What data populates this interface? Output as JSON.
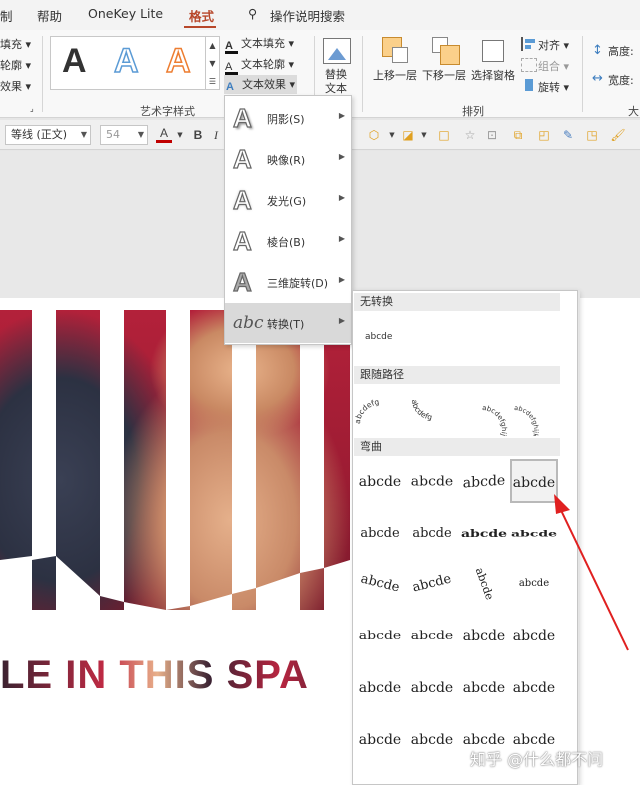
{
  "tabs": [
    {
      "label": "制"
    },
    {
      "label": "帮助"
    },
    {
      "label": "OneKey Lite"
    },
    {
      "label": "格式"
    },
    {
      "label": "操作说明搜索"
    }
  ],
  "ribbon": {
    "left_stub": [
      "填充 ▾",
      "轮廓 ▾",
      "效果 ▾"
    ],
    "wordart_samples": [
      "A",
      "A",
      "A"
    ],
    "wordart_colors": [
      "#111111",
      "#5b9bd5",
      "#ed7d31"
    ],
    "text_fill": "文本填充 ▾",
    "text_outline": "文本轮廓 ▾",
    "text_effects": "文本效果 ▾",
    "wordart_group": "艺术字样式",
    "replace_text_line1": "替换",
    "replace_text_line2": "文本",
    "bring_forward": "上移一层",
    "send_backward": "下移一层",
    "selection_pane": "选择窗格",
    "align": "对齐 ▾",
    "group": "组合 ▾",
    "rotate": "旋转 ▾",
    "arrange_group": "排列",
    "height": "高度:",
    "width": "宽度:",
    "size_stub": "大"
  },
  "formatbar": {
    "font": "等线 (正文)",
    "size": "54",
    "bold": "B",
    "italic": "I"
  },
  "slide": {
    "headline": "LE   IN THIS   SPA"
  },
  "effects_menu": [
    {
      "label": "阴影(S)",
      "glyph": "A"
    },
    {
      "label": "映像(R)",
      "glyph": "A"
    },
    {
      "label": "发光(G)",
      "glyph": "A"
    },
    {
      "label": "棱台(B)",
      "glyph": "A"
    },
    {
      "label": "三维旋转(D)",
      "glyph": "A"
    },
    {
      "label": "转换(T)",
      "glyph": "abc"
    }
  ],
  "transform": {
    "no_transform": "无转换",
    "no_transform_sample": "abcde",
    "follow_path": "跟随路径",
    "warp": "弯曲",
    "path_samples": [
      "abcdefg",
      "abcdefg",
      "abcdefghijklm",
      "abcdefghijklmnop"
    ],
    "warp_samples": [
      "abcde",
      "abcde",
      "abcde",
      "abcde",
      "abcde",
      "abcde",
      "abcde",
      "abcde",
      "abcde",
      "abcde",
      "abcde",
      "abcde",
      "abcde",
      "abcde",
      "abcde",
      "abcde",
      "abcde",
      "abcde",
      "abcde",
      "abcde",
      "abcde",
      "abcde",
      "abcde",
      "abcde"
    ]
  },
  "watermark": "知乎 @什么都不问",
  "colors": {
    "accent": "#b7472a",
    "arrow": "#e02020"
  }
}
